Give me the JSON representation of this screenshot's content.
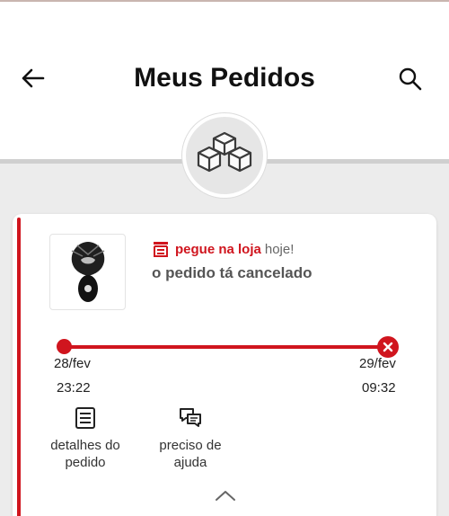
{
  "header": {
    "title": "Meus Pedidos",
    "back_icon": "arrow-left-icon",
    "search_icon": "search-icon"
  },
  "hero": {
    "icon": "boxes-icon"
  },
  "order": {
    "store_label": "pegue na loja",
    "store_when": "hoje!",
    "status": "o pedido tá cancelado",
    "timeline": {
      "start_date": "28/fev",
      "start_time": "23:22",
      "end_date": "29/fev",
      "end_time": "09:32"
    },
    "actions": [
      {
        "label": "detalhes do pedido",
        "icon": "receipt-list-icon"
      },
      {
        "label": "preciso de ajuda",
        "icon": "chat-bubbles-icon"
      }
    ]
  },
  "colors": {
    "accent": "#d0151e",
    "background": "#ececec"
  }
}
